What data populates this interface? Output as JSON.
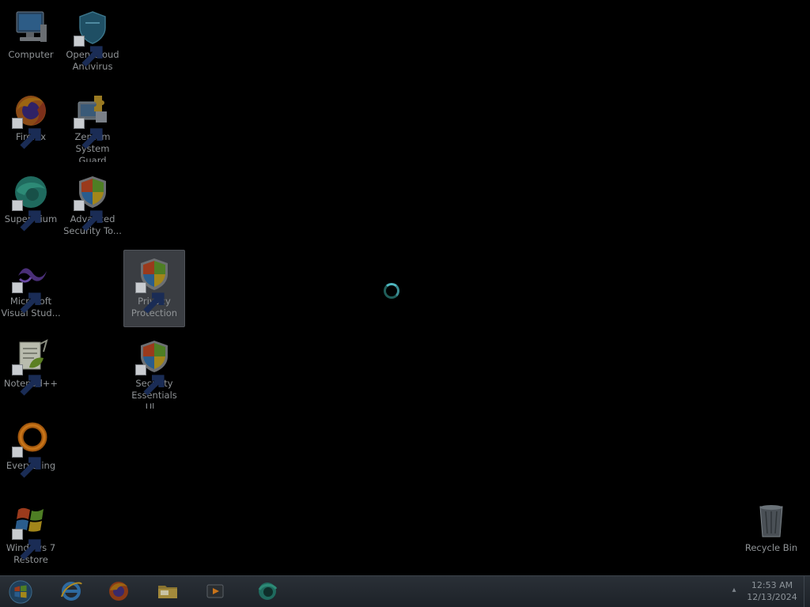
{
  "desktop": {
    "icons": [
      {
        "label": "Computer",
        "icon": "computer-icon",
        "shortcut": false
      },
      {
        "label": "Open Cloud\nAntivirus",
        "icon": "shield-icon",
        "shortcut": true
      },
      {
        "label": "Firefox",
        "icon": "firefox-icon",
        "shortcut": true
      },
      {
        "label": "Zentom\nSystem Guard",
        "icon": "computer-puzzle-icon",
        "shortcut": true
      },
      {
        "label": "Supermium",
        "icon": "supermium-icon",
        "shortcut": true
      },
      {
        "label": "Advanced\nSecurity To...",
        "icon": "windows-shield-icon",
        "shortcut": true
      },
      {
        "label": "Microsoft\nVisual Stud...",
        "icon": "visual-studio-icon",
        "shortcut": true
      },
      {
        "label": "Privacy\nProtection",
        "icon": "windows-shield-icon",
        "shortcut": true,
        "selected": true
      },
      {
        "label": "Notepad++",
        "icon": "notepadpp-icon",
        "shortcut": true
      },
      {
        "label": "Security\nEssentials Ul...",
        "icon": "windows-shield-icon",
        "shortcut": true
      },
      {
        "label": "Everything",
        "icon": "everything-icon",
        "shortcut": true
      },
      {
        "label": "Windows 7\nRestore",
        "icon": "windows-logo-icon",
        "shortcut": true
      },
      {
        "label": "Recycle Bin",
        "icon": "recycle-bin-icon",
        "shortcut": false
      }
    ]
  },
  "taskbar": {
    "pinned": [
      "internet-explorer-icon",
      "firefox-icon",
      "folder-icon",
      "media-player-icon",
      "supermium-icon"
    ],
    "clock_time": "12:53 AM",
    "clock_date": "12/13/2024"
  },
  "colors": {
    "spinner": "#4fb7c0",
    "selection": "#3a3d42"
  }
}
